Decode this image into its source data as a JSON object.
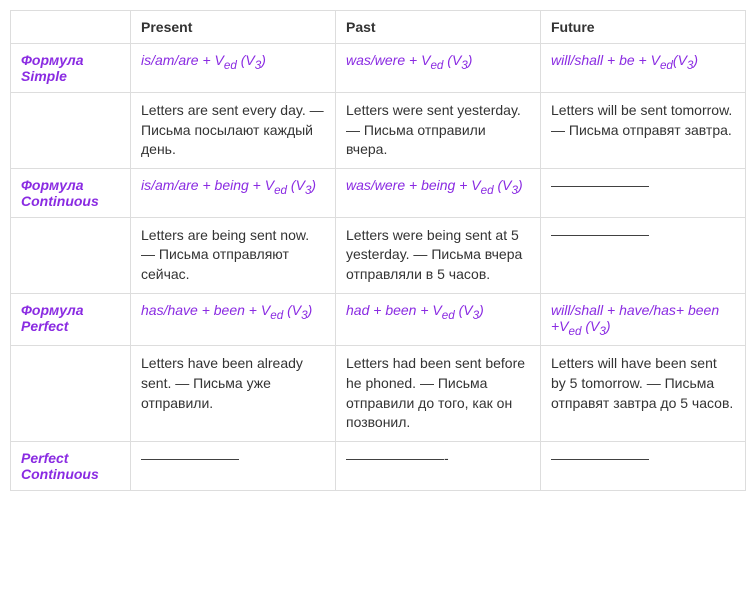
{
  "headers": {
    "present": "Present",
    "past": "Past",
    "future": "Future"
  },
  "rows": {
    "simple": {
      "label": "Формула Simple",
      "present_formula_pre": "is/am/are + V",
      "present_formula_sub": "ed",
      "present_formula_post": " (V",
      "present_formula_sub2": "3",
      "present_formula_end": ")",
      "past_formula_pre": "was/were + V",
      "past_formula_sub": "ed",
      "past_formula_post": " (V",
      "past_formula_sub2": "3",
      "past_formula_end": ")",
      "future_formula_pre": "will/shall + be + V",
      "future_formula_sub": "ed",
      "future_formula_post": "(V",
      "future_formula_sub2": "3",
      "future_formula_end": ")",
      "present_example": " Letters are sent every day. — Письма посылают каждый день.",
      "past_example": " Letters were sent yesterday. — Письма отправили вчера.",
      "future_example": " Letters will be sent tomorrow. — Письма отправят завтра."
    },
    "continuous": {
      "label": "Формула Continuous",
      "present_formula_pre": "is/am/are + being + V",
      "present_formula_sub": "ed",
      "present_formula_post": " (V",
      "present_formula_sub2": "3",
      "present_formula_end": ")",
      "past_formula_pre": "was/were + being + V",
      "past_formula_sub": "ed",
      "past_formula_post": " (V",
      "past_formula_sub2": "3",
      "past_formula_end": ")",
      "future_formula": "———————",
      "present_example": " Letters are being sent now. — Письма отправляют сейчас.",
      "past_example": " Letters were being sent at 5 yesterday. — Письма вчера отправляли в 5 часов.",
      "future_example": "———————"
    },
    "perfect": {
      "label": "Формула Perfect",
      "present_formula_pre": "has/have + been + V",
      "present_formula_sub": "ed",
      "present_formula_post": " (V",
      "present_formula_sub2": "3",
      "present_formula_end": ")",
      "past_formula_pre": "had + been + V",
      "past_formula_sub": "ed",
      "past_formula_post": " (V",
      "past_formula_sub2": "3",
      "past_formula_end": ")",
      "future_formula_pre": "will/shall + have/has+ been +V",
      "future_formula_sub": "ed",
      "future_formula_post": " (V",
      "future_formula_sub2": "3",
      "future_formula_end": ")",
      "present_example": " Letters have been already sent. — Письма уже отправили.",
      "past_example": " Letters had been sent before he phoned. — Письма отправили до того, как он позвонил.",
      "future_example": " Letters will have been sent by 5 tomorrow. — Письма отправят завтра до 5 часов."
    },
    "perfect_continuous": {
      "label": "Perfect Continuous",
      "present": "———————",
      "past": "———————-",
      "future": "———————"
    }
  }
}
